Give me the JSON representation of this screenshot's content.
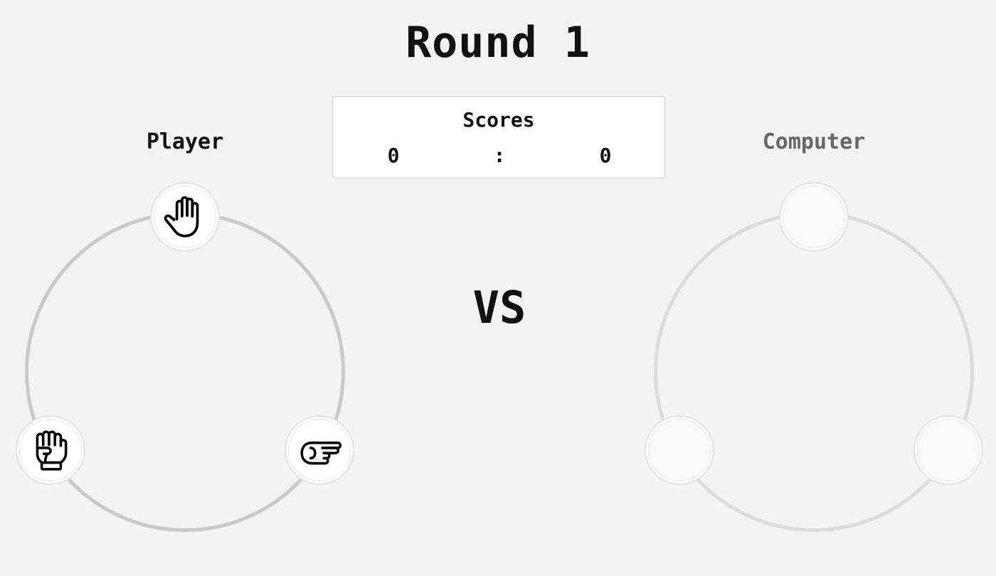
{
  "round": {
    "title": "Round 1"
  },
  "scores": {
    "label": "Scores",
    "player": "0",
    "separator": ":",
    "computer": "0"
  },
  "player": {
    "label": "Player",
    "choices": [
      {
        "name": "paper",
        "icon": "hand-paper-icon"
      },
      {
        "name": "rock",
        "icon": "hand-rock-icon"
      },
      {
        "name": "scissors",
        "icon": "hand-scissors-icon"
      }
    ]
  },
  "computer": {
    "label": "Computer",
    "choices": [
      {
        "name": "empty"
      },
      {
        "name": "empty"
      },
      {
        "name": "empty"
      }
    ]
  },
  "vs": {
    "label": "VS"
  },
  "colors": {
    "background": "#f3f3f3",
    "player_ring": "#c9c9c9",
    "computer_ring": "#dcdcdc",
    "computer_label": "#666666"
  }
}
